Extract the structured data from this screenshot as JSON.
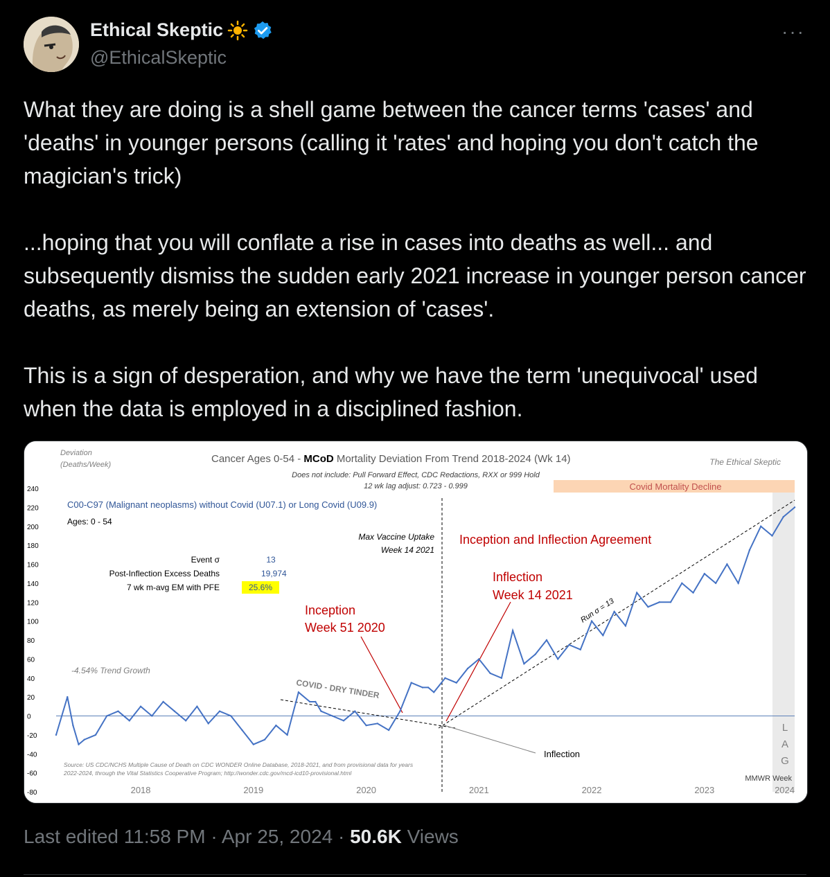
{
  "tweet": {
    "display_name": "Ethical Skeptic",
    "handle": "@EthicalSkeptic",
    "paragraphs": [
      "What they are doing is a shell game between the cancer terms 'cases' and 'deaths' in younger persons (calling it 'rates' and hoping you don't catch the magician's trick)",
      "...hoping that you will conflate a rise in cases into deaths as well... and subsequently dismiss the sudden early 2021 increase in younger person cancer deaths, as merely being an extension of 'cases'.",
      "This is a sign of desperation, and why we have the term 'unequivocal' used when the data is employed in a disciplined fashion."
    ],
    "edited": "Last edited 11:58 PM · Apr 25, 2024 · ",
    "views_count": "50.6K",
    "views_label": " Views",
    "more_glyph": "···"
  },
  "icons": [
    "avatar",
    "sun-emoji-icon",
    "verified-badge-icon",
    "more-icon"
  ],
  "colors": {
    "background": "#000000",
    "text": "#e7e9ea",
    "muted": "#71767b",
    "verified": "#1d9bf0",
    "series": "#4472c4",
    "annotation_red": "#c00000",
    "covid_band": "#fcd5b4"
  },
  "chart_data": {
    "type": "line",
    "title_pre": "Cancer  Ages 0-54 - ",
    "title_bold": "MCoD",
    "title_post": " Mortality Deviation From Trend  2018-2024 (Wk 14)",
    "subtitle1": "Does not include: Pull Forward Effect,  CDC Redactions, RXX or 999 Hold",
    "subtitle2": "12 wk lag adjust: 0.723 - 0.999",
    "brand": "The Ethical Skeptic",
    "ylabel1": "Deviation",
    "ylabel2": "(Deaths/Week)",
    "y_ticks": [
      "240",
      "220",
      "200",
      "180",
      "160",
      "140",
      "120",
      "100",
      "80",
      "60",
      "40",
      "20",
      "0",
      "-20",
      "-40",
      "-60",
      "-80"
    ],
    "ylim": [
      -80,
      240
    ],
    "x_ticks": [
      {
        "label": "2018",
        "x": 2018.5
      },
      {
        "label": "2019",
        "x": 2019.5
      },
      {
        "label": "2020",
        "x": 2020.5
      },
      {
        "label": "2021",
        "x": 2021.5
      },
      {
        "label": "2022",
        "x": 2022.5
      },
      {
        "label": "2023",
        "x": 2023.5
      },
      {
        "label": "2024",
        "x": 2024.3
      }
    ],
    "xlim": [
      2017.75,
      2024.3
    ],
    "series_label": "C00-C97 (Malignant neoplasms) without Covid (U07.1) or Long Covid (U09.9)",
    "ages": "Ages: 0 - 54",
    "stats": [
      {
        "label": "Event σ",
        "value": "13"
      },
      {
        "label": "Post-Inflection Excess Deaths",
        "value": "19,974"
      },
      {
        "label": "7 wk m-avg EM with PFE",
        "value": "25.6%"
      }
    ],
    "trend_growth": "-4.54% Trend Growth",
    "covid_band": "Covid Mortality Decline",
    "max_vax_1": "Max Vaccine Uptake",
    "max_vax_2": "Week 14 2021",
    "agreement": "Inception and Inflection Agreement",
    "inflection_1": "Inflection",
    "inflection_2": "Week 14 2021",
    "inception_1": "Inception",
    "inception_2": "Week 51 2020",
    "dry_tinder": "COVID - DRY TINDER",
    "run_sigma": "Run σ = 13",
    "inflection_pt": "Inflection",
    "lag": [
      "L",
      "A",
      "G"
    ],
    "source1": "Source: US CDC/NCHS Multiple Cause of Death on CDC WONDER Online Database, 2018-2021, and from provisional data for years",
    "source2": "2022-2024, through the Vital Statistics Cooperative Program; http://wonder.cdc.gov/mcd-icd10-provisional.html",
    "mmwr": "MMWR Week",
    "x": [
      2017.75,
      2017.85,
      2017.9,
      2017.95,
      2018.0,
      2018.1,
      2018.2,
      2018.3,
      2018.4,
      2018.5,
      2018.6,
      2018.7,
      2018.8,
      2018.9,
      2019.0,
      2019.1,
      2019.2,
      2019.3,
      2019.4,
      2019.5,
      2019.6,
      2019.7,
      2019.8,
      2019.9,
      2020.0,
      2020.05,
      2020.1,
      2020.2,
      2020.3,
      2020.4,
      2020.5,
      2020.6,
      2020.7,
      2020.8,
      2020.9,
      2021.0,
      2021.05,
      2021.1,
      2021.2,
      2021.3,
      2021.4,
      2021.5,
      2021.6,
      2021.7,
      2021.8,
      2021.9,
      2022.0,
      2022.1,
      2022.2,
      2022.3,
      2022.4,
      2022.5,
      2022.6,
      2022.7,
      2022.8,
      2022.9,
      2023.0,
      2023.1,
      2023.2,
      2023.3,
      2023.4,
      2023.5,
      2023.6,
      2023.7,
      2023.8,
      2023.9,
      2024.0,
      2024.1,
      2024.2,
      2024.3
    ],
    "values": [
      -20,
      20,
      -10,
      -30,
      -25,
      -20,
      0,
      5,
      -5,
      10,
      0,
      15,
      5,
      -5,
      10,
      -8,
      5,
      0,
      -15,
      -30,
      -25,
      -10,
      -20,
      25,
      15,
      15,
      5,
      0,
      -5,
      5,
      -10,
      -8,
      -15,
      5,
      35,
      30,
      30,
      25,
      40,
      35,
      50,
      60,
      45,
      40,
      90,
      55,
      65,
      80,
      60,
      75,
      70,
      100,
      85,
      110,
      95,
      130,
      115,
      120,
      120,
      140,
      130,
      150,
      140,
      160,
      140,
      175,
      200,
      190,
      210,
      220
    ]
  }
}
